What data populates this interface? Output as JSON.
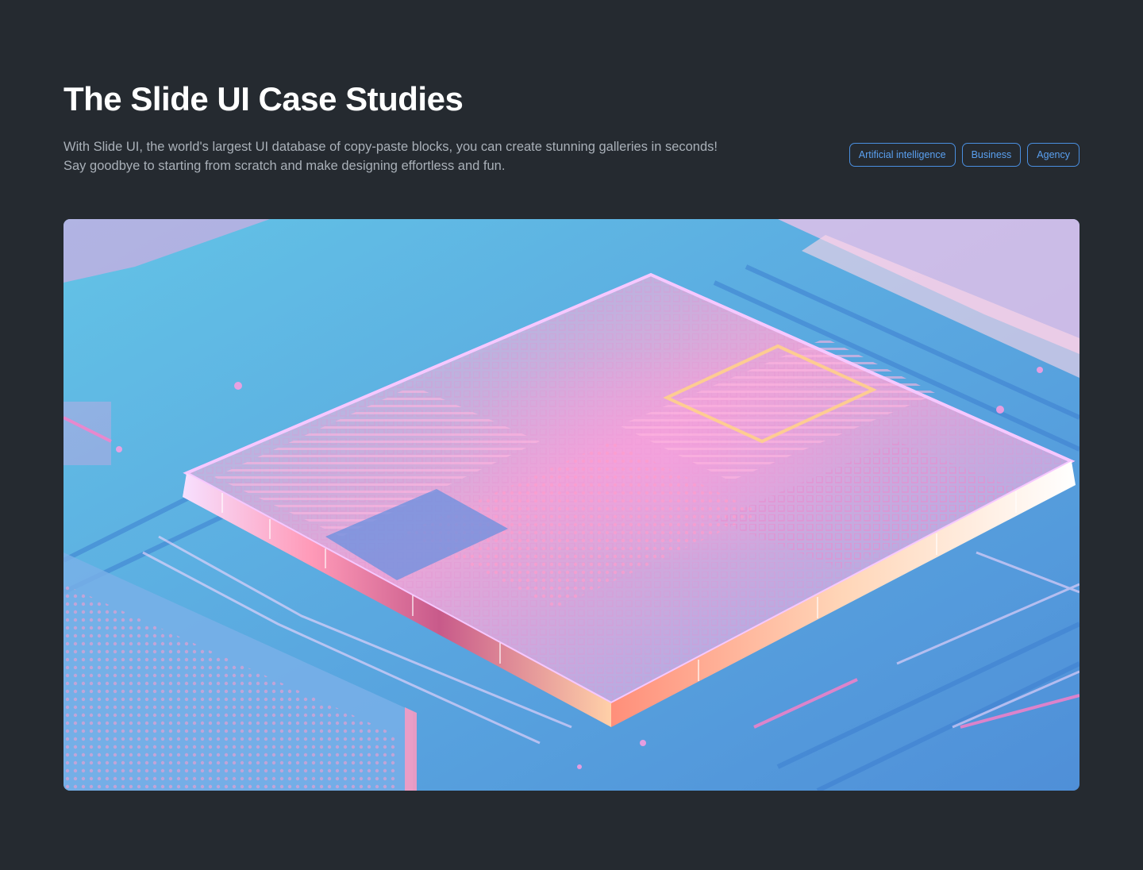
{
  "header": {
    "title": "The Slide UI Case Studies",
    "description_line_1": "With Slide UI, the world's largest UI database of copy-paste blocks, you can create stunning galleries in seconds!",
    "description_line_2": "Say goodbye to starting from scratch and make designing effortless and fun."
  },
  "tags": [
    {
      "label": "Artificial intelligence"
    },
    {
      "label": "Business"
    },
    {
      "label": "Agency"
    }
  ],
  "hero": {
    "image_subject": "isometric-microchip-illustration"
  },
  "colors": {
    "background": "#252a30",
    "title": "#ffffff",
    "description": "#a9b0b8",
    "tag_accent": "#4a8fe0"
  }
}
